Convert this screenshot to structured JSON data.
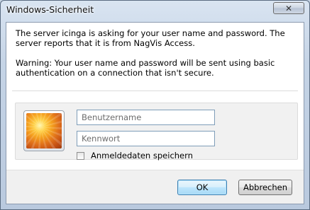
{
  "window": {
    "title": "Windows-Sicherheit",
    "close_label": "✕"
  },
  "message": {
    "line1": "The server icinga is asking for your user name and password. The server reports that it is from NagVis Access.",
    "warning": "Warning: Your user name and password will be sent using basic authentication on a connection that isn't secure."
  },
  "credentials": {
    "username_placeholder": "Benutzername",
    "username_value": "",
    "password_placeholder": "Kennwort",
    "password_value": "",
    "remember_label": "Anmeldedaten speichern",
    "remember_checked": false
  },
  "buttons": {
    "ok": "OK",
    "cancel": "Abbrechen"
  }
}
